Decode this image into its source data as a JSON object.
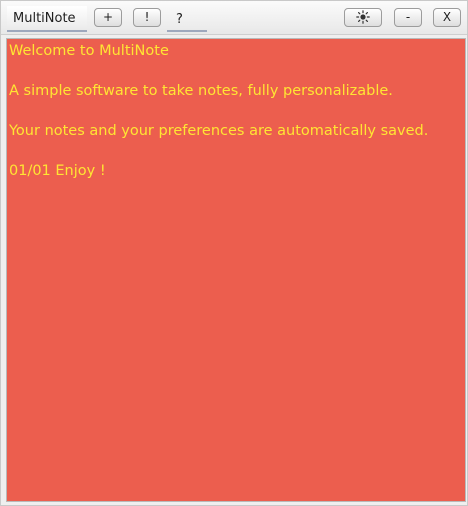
{
  "app": {
    "title": "MultiNote"
  },
  "toolbar": {
    "add_label": "+",
    "important_label": "!",
    "help_label": "?",
    "theme_icon": "sun-icon",
    "minimize_label": "-",
    "close_label": "X"
  },
  "note": {
    "background_color": "#ec5e4e",
    "text_color": "#ffe533",
    "lines": [
      "Welcome to MultiNote",
      "A simple software to take notes, fully personalizable.",
      "Your notes and your preferences are automatically saved.",
      "01/01 Enjoy !"
    ]
  }
}
